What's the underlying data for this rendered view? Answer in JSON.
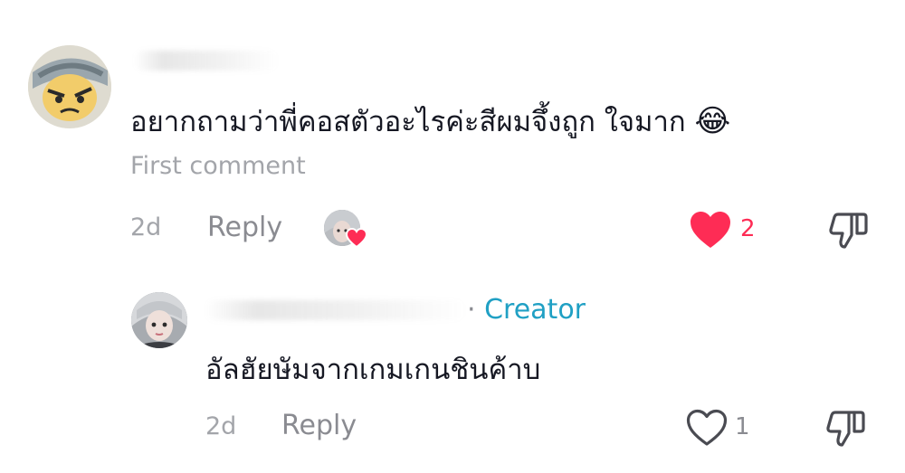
{
  "comments": [
    {
      "text": "อยากถามว่าพี่คอสตัวอะไรค่ะสีผมจึ้งถูก ใจมาก",
      "emoji": "😂",
      "tag": "First comment",
      "time": "2d",
      "reply_label": "Reply",
      "likes": "2",
      "liked": true,
      "accent_color": "#fe2c55"
    },
    {
      "separator": "·",
      "badge": "Creator",
      "text": "อัลฮัยษัมจากเกมเกนชินค้าบ",
      "time": "2d",
      "reply_label": "Reply",
      "likes": "1",
      "liked": false,
      "badge_color": "#20a0c4"
    }
  ],
  "icons": {
    "liked_heart": "heart-filled-icon",
    "heart": "heart-outline-icon",
    "dislike": "thumbs-down-icon"
  }
}
